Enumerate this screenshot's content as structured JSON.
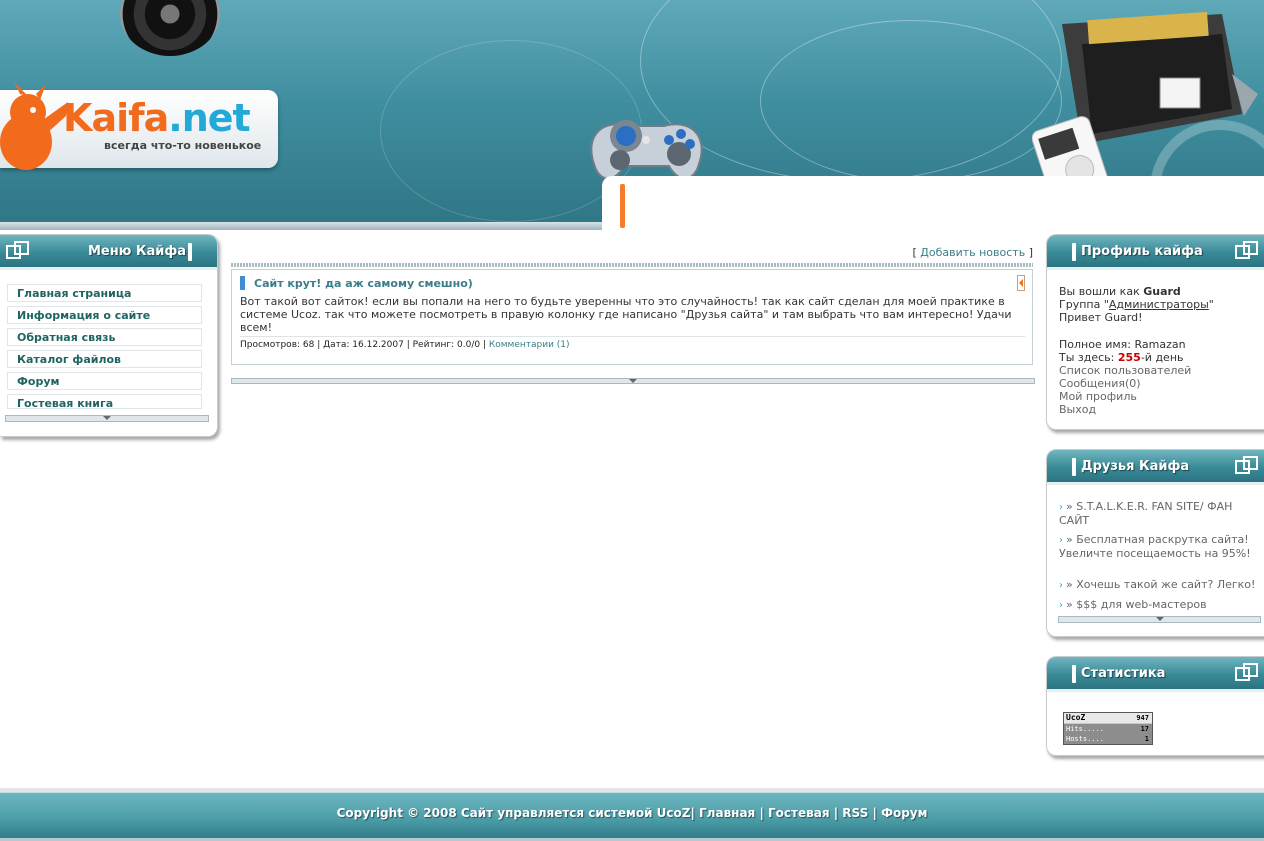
{
  "header": {
    "logo_part1": "Kaifa",
    "logo_part2": ".net",
    "slogan": "всегда что-то новенькое"
  },
  "menu": {
    "title": "Меню Кайфа",
    "items": [
      {
        "label": "Главная страница"
      },
      {
        "label": "Информация о сайте"
      },
      {
        "label": "Обратная связь"
      },
      {
        "label": "Каталог файлов"
      },
      {
        "label": "Форум"
      },
      {
        "label": "Гостевая книга"
      }
    ]
  },
  "content": {
    "add_news_open": "[",
    "add_news_label": "Добавить новость",
    "add_news_close": "]",
    "news": {
      "title": "Сайт крут! да аж самому смешно)",
      "body": "Вот такой вот сайток! если вы попали на него то будьте уверенны что это случайность! так как сайт сделан для моей практике в системе Ucoz. так что можете посмотреть в правую колонку где написано \"Друзья сайта\" и там выбрать что вам интересно! Удачи всем!",
      "meta_views": "Просмотров: 68",
      "meta_date": "Дата: 16.12.2007",
      "meta_rating": "Рейтинг: 0.0/0",
      "comments_label": "Комментарии (1)"
    }
  },
  "profile": {
    "title": "Профиль кайфа",
    "logged_prefix": "Вы вошли как ",
    "username": "Guard",
    "group_prefix": "Группа \"",
    "group_name": "Администраторы",
    "group_suffix": "\"",
    "greeting": "Привет Guard!",
    "full_name_line": "Полное имя: Ramazan",
    "day_prefix": "Ты здесь: ",
    "day_count": "255",
    "day_suffix": "-й день",
    "link_users": "Список пользователей",
    "link_messages": "Сообщения(0)",
    "link_profile": "Мой профиль",
    "link_logout": "Выход"
  },
  "friends": {
    "title": "Друзья Кайфа",
    "items": [
      {
        "label": "» S.T.A.L.K.E.R. FAN SITE/ ФАН САЙТ"
      },
      {
        "label": "» Бесплатная раскрутка сайта! Увеличте посещаемость на 95%!"
      },
      {
        "label": "» Хочешь такой же сайт? Легко!"
      },
      {
        "label": "» $$$ для web-мастеров"
      }
    ]
  },
  "stats": {
    "title": "Статистика",
    "counter_logo": "UcoZ",
    "counter_total": "947",
    "hits_label": "Hits.....",
    "hits_value": "17",
    "hosts_label": "Hosts....",
    "hosts_value": "1"
  },
  "footer": {
    "copyright": "Copyright © 2008 Сайт управляется системой UcoZ",
    "link_home": "Главная",
    "link_guestbook": "Гостевая",
    "link_rss": "RSS",
    "link_forum": "Форум",
    "separator": "|"
  },
  "colors": {
    "accent_teal": "#3a8a97",
    "link_teal": "#3a7e8a",
    "orange": "#f37b2a",
    "day_count_red": "#cc0000"
  }
}
